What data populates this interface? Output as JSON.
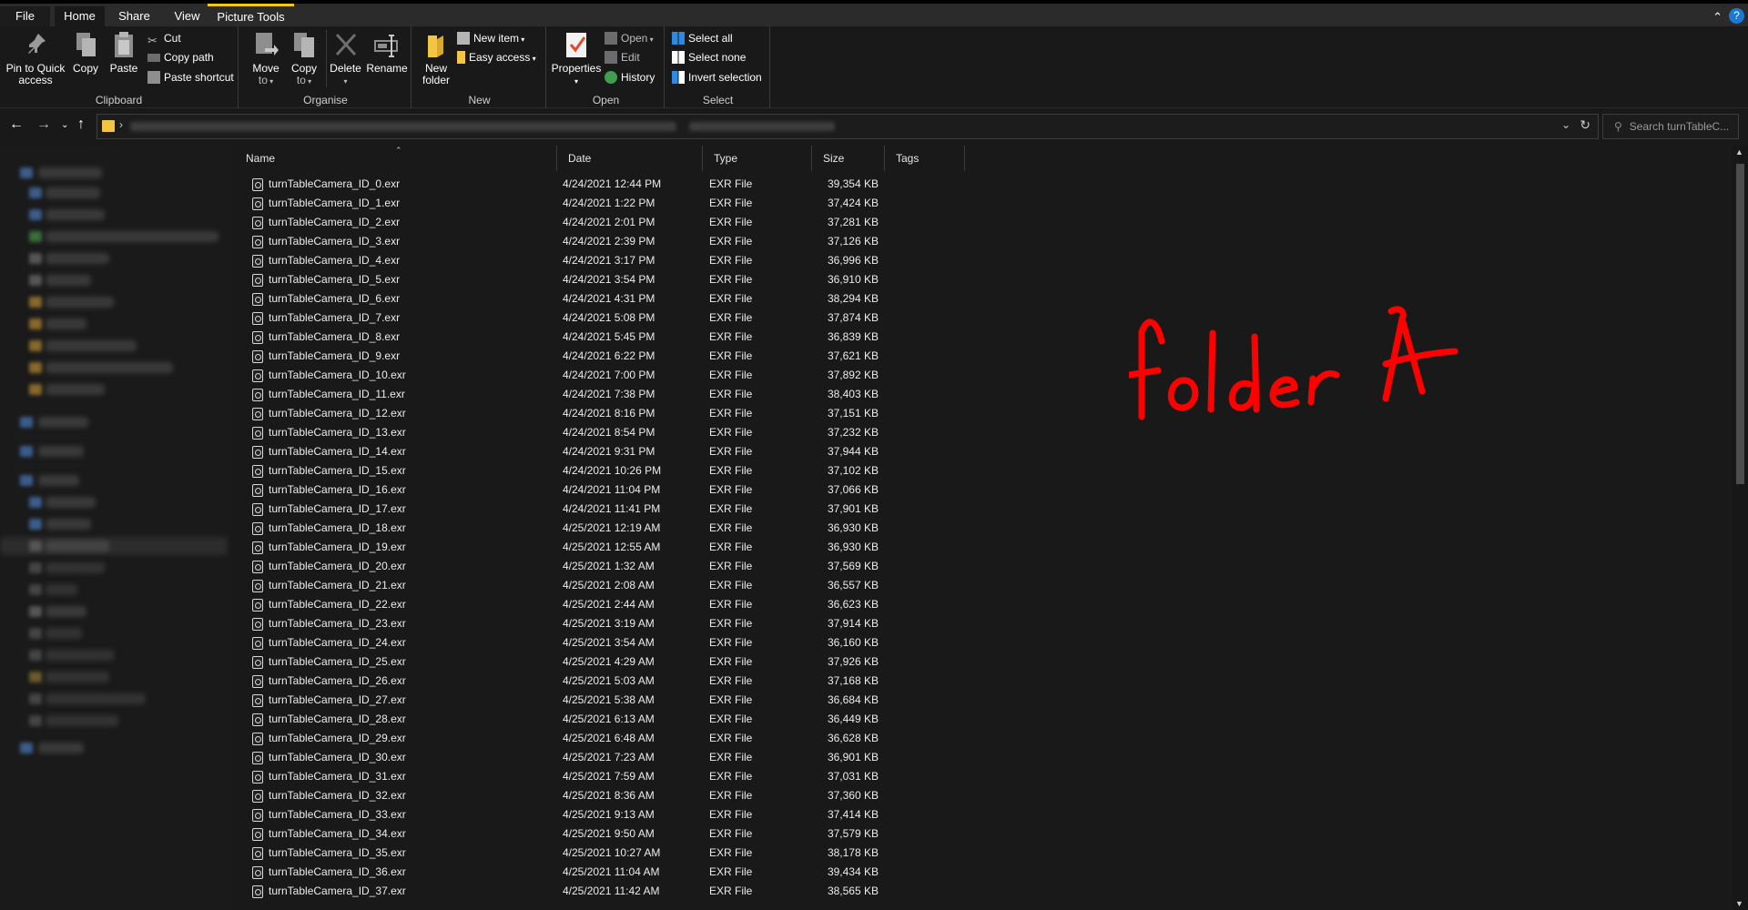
{
  "ribbon_tabs": {
    "file": "File",
    "home": "Home",
    "share": "Share",
    "view": "View",
    "picture_tools": "Picture Tools"
  },
  "ribbon": {
    "clipboard": {
      "label": "Clipboard",
      "pin_line1": "Pin to Quick",
      "pin_line2": "access",
      "copy": "Copy",
      "paste": "Paste",
      "cut": "Cut",
      "copy_path": "Copy path",
      "paste_shortcut": "Paste shortcut"
    },
    "organise": {
      "label": "Organise",
      "move_line1": "Move",
      "move_line2": "to",
      "copy_line1": "Copy",
      "copy_line2": "to",
      "delete": "Delete",
      "rename": "Rename"
    },
    "new": {
      "label": "New",
      "folder_line1": "New",
      "folder_line2": "folder",
      "new_item": "New item",
      "easy_access": "Easy access"
    },
    "open": {
      "label": "Open",
      "properties": "Properties",
      "open": "Open",
      "edit": "Edit",
      "history": "History"
    },
    "select": {
      "label": "Select",
      "select_all": "Select all",
      "select_none": "Select none",
      "invert_selection": "Invert selection"
    }
  },
  "search": {
    "placeholder": "Search turnTableC..."
  },
  "columns": {
    "name": "Name",
    "date": "Date",
    "type": "Type",
    "size": "Size",
    "tags": "Tags"
  },
  "files": [
    {
      "name": "turnTableCamera_ID_0.exr",
      "date": "4/24/2021 12:44 PM",
      "type": "EXR File",
      "size": "39,354 KB"
    },
    {
      "name": "turnTableCamera_ID_1.exr",
      "date": "4/24/2021 1:22 PM",
      "type": "EXR File",
      "size": "37,424 KB"
    },
    {
      "name": "turnTableCamera_ID_2.exr",
      "date": "4/24/2021 2:01 PM",
      "type": "EXR File",
      "size": "37,281 KB"
    },
    {
      "name": "turnTableCamera_ID_3.exr",
      "date": "4/24/2021 2:39 PM",
      "type": "EXR File",
      "size": "37,126 KB"
    },
    {
      "name": "turnTableCamera_ID_4.exr",
      "date": "4/24/2021 3:17 PM",
      "type": "EXR File",
      "size": "36,996 KB"
    },
    {
      "name": "turnTableCamera_ID_5.exr",
      "date": "4/24/2021 3:54 PM",
      "type": "EXR File",
      "size": "36,910 KB"
    },
    {
      "name": "turnTableCamera_ID_6.exr",
      "date": "4/24/2021 4:31 PM",
      "type": "EXR File",
      "size": "38,294 KB"
    },
    {
      "name": "turnTableCamera_ID_7.exr",
      "date": "4/24/2021 5:08 PM",
      "type": "EXR File",
      "size": "37,874 KB"
    },
    {
      "name": "turnTableCamera_ID_8.exr",
      "date": "4/24/2021 5:45 PM",
      "type": "EXR File",
      "size": "36,839 KB"
    },
    {
      "name": "turnTableCamera_ID_9.exr",
      "date": "4/24/2021 6:22 PM",
      "type": "EXR File",
      "size": "37,621 KB"
    },
    {
      "name": "turnTableCamera_ID_10.exr",
      "date": "4/24/2021 7:00 PM",
      "type": "EXR File",
      "size": "37,892 KB"
    },
    {
      "name": "turnTableCamera_ID_11.exr",
      "date": "4/24/2021 7:38 PM",
      "type": "EXR File",
      "size": "38,403 KB"
    },
    {
      "name": "turnTableCamera_ID_12.exr",
      "date": "4/24/2021 8:16 PM",
      "type": "EXR File",
      "size": "37,151 KB"
    },
    {
      "name": "turnTableCamera_ID_13.exr",
      "date": "4/24/2021 8:54 PM",
      "type": "EXR File",
      "size": "37,232 KB"
    },
    {
      "name": "turnTableCamera_ID_14.exr",
      "date": "4/24/2021 9:31 PM",
      "type": "EXR File",
      "size": "37,944 KB"
    },
    {
      "name": "turnTableCamera_ID_15.exr",
      "date": "4/24/2021 10:26 PM",
      "type": "EXR File",
      "size": "37,102 KB"
    },
    {
      "name": "turnTableCamera_ID_16.exr",
      "date": "4/24/2021 11:04 PM",
      "type": "EXR File",
      "size": "37,066 KB"
    },
    {
      "name": "turnTableCamera_ID_17.exr",
      "date": "4/24/2021 11:41 PM",
      "type": "EXR File",
      "size": "37,901 KB"
    },
    {
      "name": "turnTableCamera_ID_18.exr",
      "date": "4/25/2021 12:19 AM",
      "type": "EXR File",
      "size": "36,930 KB"
    },
    {
      "name": "turnTableCamera_ID_19.exr",
      "date": "4/25/2021 12:55 AM",
      "type": "EXR File",
      "size": "36,930 KB"
    },
    {
      "name": "turnTableCamera_ID_20.exr",
      "date": "4/25/2021 1:32 AM",
      "type": "EXR File",
      "size": "37,569 KB"
    },
    {
      "name": "turnTableCamera_ID_21.exr",
      "date": "4/25/2021 2:08 AM",
      "type": "EXR File",
      "size": "36,557 KB"
    },
    {
      "name": "turnTableCamera_ID_22.exr",
      "date": "4/25/2021 2:44 AM",
      "type": "EXR File",
      "size": "36,623 KB"
    },
    {
      "name": "turnTableCamera_ID_23.exr",
      "date": "4/25/2021 3:19 AM",
      "type": "EXR File",
      "size": "37,914 KB"
    },
    {
      "name": "turnTableCamera_ID_24.exr",
      "date": "4/25/2021 3:54 AM",
      "type": "EXR File",
      "size": "36,160 KB"
    },
    {
      "name": "turnTableCamera_ID_25.exr",
      "date": "4/25/2021 4:29 AM",
      "type": "EXR File",
      "size": "37,926 KB"
    },
    {
      "name": "turnTableCamera_ID_26.exr",
      "date": "4/25/2021 5:03 AM",
      "type": "EXR File",
      "size": "37,168 KB"
    },
    {
      "name": "turnTableCamera_ID_27.exr",
      "date": "4/25/2021 5:38 AM",
      "type": "EXR File",
      "size": "36,684 KB"
    },
    {
      "name": "turnTableCamera_ID_28.exr",
      "date": "4/25/2021 6:13 AM",
      "type": "EXR File",
      "size": "36,449 KB"
    },
    {
      "name": "turnTableCamera_ID_29.exr",
      "date": "4/25/2021 6:48 AM",
      "type": "EXR File",
      "size": "36,628 KB"
    },
    {
      "name": "turnTableCamera_ID_30.exr",
      "date": "4/25/2021 7:23 AM",
      "type": "EXR File",
      "size": "36,901 KB"
    },
    {
      "name": "turnTableCamera_ID_31.exr",
      "date": "4/25/2021 7:59 AM",
      "type": "EXR File",
      "size": "37,031 KB"
    },
    {
      "name": "turnTableCamera_ID_32.exr",
      "date": "4/25/2021 8:36 AM",
      "type": "EXR File",
      "size": "37,360 KB"
    },
    {
      "name": "turnTableCamera_ID_33.exr",
      "date": "4/25/2021 9:13 AM",
      "type": "EXR File",
      "size": "37,414 KB"
    },
    {
      "name": "turnTableCamera_ID_34.exr",
      "date": "4/25/2021 9:50 AM",
      "type": "EXR File",
      "size": "37,579 KB"
    },
    {
      "name": "turnTableCamera_ID_35.exr",
      "date": "4/25/2021 10:27 AM",
      "type": "EXR File",
      "size": "38,178 KB"
    },
    {
      "name": "turnTableCamera_ID_36.exr",
      "date": "4/25/2021 11:04 AM",
      "type": "EXR File",
      "size": "39,434 KB"
    },
    {
      "name": "turnTableCamera_ID_37.exr",
      "date": "4/25/2021 11:42 AM",
      "type": "EXR File",
      "size": "38,565 KB"
    }
  ],
  "annotation": {
    "text": "folder A",
    "color": "#ff0000"
  },
  "colors": {
    "background": "#191919",
    "accent_tab": "#f2c811",
    "help": "#1a79d6",
    "folder": "#f4c542"
  }
}
